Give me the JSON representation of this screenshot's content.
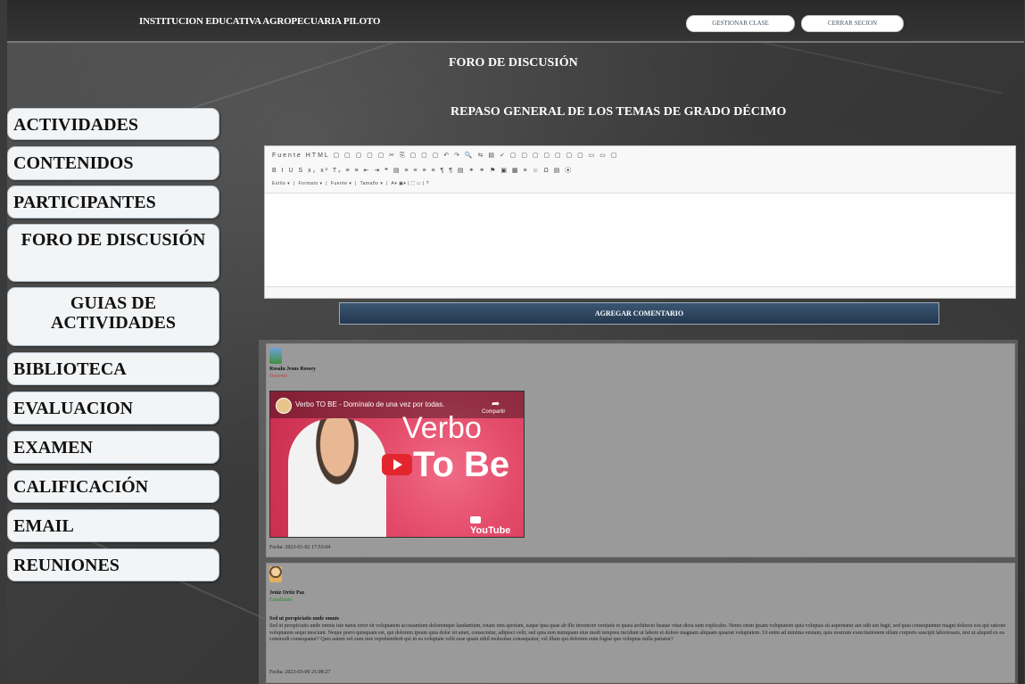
{
  "header": {
    "school_name": "INSTITUCION EDUCATIVA AGROPECUARIA PILOTO",
    "buttons": {
      "manage": "GESTIONAR CLASE",
      "logout": "CERRAR SECION"
    }
  },
  "page": {
    "title": "FORO DE DISCUSIÓN",
    "subtitle": "REPASO GENERAL DE LOS TEMAS DE GRADO DÉCIMO"
  },
  "sidebar": {
    "items": [
      {
        "label": "ACTIVIDADES"
      },
      {
        "label": "CONTENIDOS"
      },
      {
        "label": "PARTICIPANTES"
      },
      {
        "label": "FORO DE DISCUSIÓN"
      },
      {
        "label": "GUIAS DE ACTIVIDADES"
      },
      {
        "label": "BIBLIOTECA"
      },
      {
        "label": "EVALUACION"
      },
      {
        "label": "EXAMEN"
      },
      {
        "label": "CALIFICACIÓN"
      },
      {
        "label": "EMAIL"
      },
      {
        "label": "REUNIONES"
      }
    ]
  },
  "editor": {
    "toolbar_row1": "Fuente HTML  ▢ ▢ ▢ ▢ ▢  ✂ ⎘ ▢ ▢ ▢  ↶ ↷  🔍 ⇆ ▤ ✓  ▢ ▢ ▢ ▢ ▢ ▢ ▢ ▭ ▭ ▢",
    "toolbar_row2": "B I U S x₂ x²  Tₓ  ≡ ≡  ⇤ ⇥ ❝ ▤  ≡ ≡ ≡ ≡  ¶ ¶ ▤  ⚭ ⚭ ⚑  ▣ ▦ ≡ ☺ Ω ▤ ⦿",
    "style_label": "Estilo",
    "format_label": "Formato",
    "font_label": "Fuente",
    "size_label": "Tamaño"
  },
  "add_comment_button": "AGREGAR COMENTARIO",
  "comments": [
    {
      "author": "Rosalu Jesus Rossey",
      "role": "Docente",
      "video": {
        "title": "Verbo TO BE - Domínalo de una vez por todas.",
        "share": "Compartir",
        "big_word1": "Verbo",
        "big_word2": "To Be",
        "platform": "YouTube"
      },
      "date": "Fecha: 2023-01-02 17:53:04"
    },
    {
      "author": "Jeniz Ortiz Paz",
      "role": "Estudiante",
      "post_title": "Sed ut perspiciatis unde omnis",
      "post_body": "Sed ut perspiciatis unde omnis iste natus error sit voluptatem accusantium doloremque laudantium, totam rem aperiam, eaque ipsa quae ab illo inventore veritatis et quasi architecto beatae vitae dicta sunt explicabo. Nemo enim ipsam voluptatem quia voluptas sit aspernatur aut odit aut fugit, sed quia consequuntur magni dolores eos qui ratione voluptatem sequi nesciunt. Neque porro quisquam est, qui dolorem ipsum quia dolor sit amet, consectetur, adipisci velit, sed quia non numquam eius modi tempora incidunt ut labore et dolore magnam aliquam quaerat voluptatem. Ut enim ad minima veniam, quis nostrum exercitationem ullam corporis suscipit laboriosam, nisi ut aliquid ex ea commodi consequatur? Quis autem vel eum iure reprehenderit qui in ea voluptate velit esse quam nihil molestiae consequatur, vel illum qui dolorem eum fugiat quo voluptas nulla pariatur?",
      "date": "Fecha: 2023-03-09 21:08:27"
    }
  ]
}
